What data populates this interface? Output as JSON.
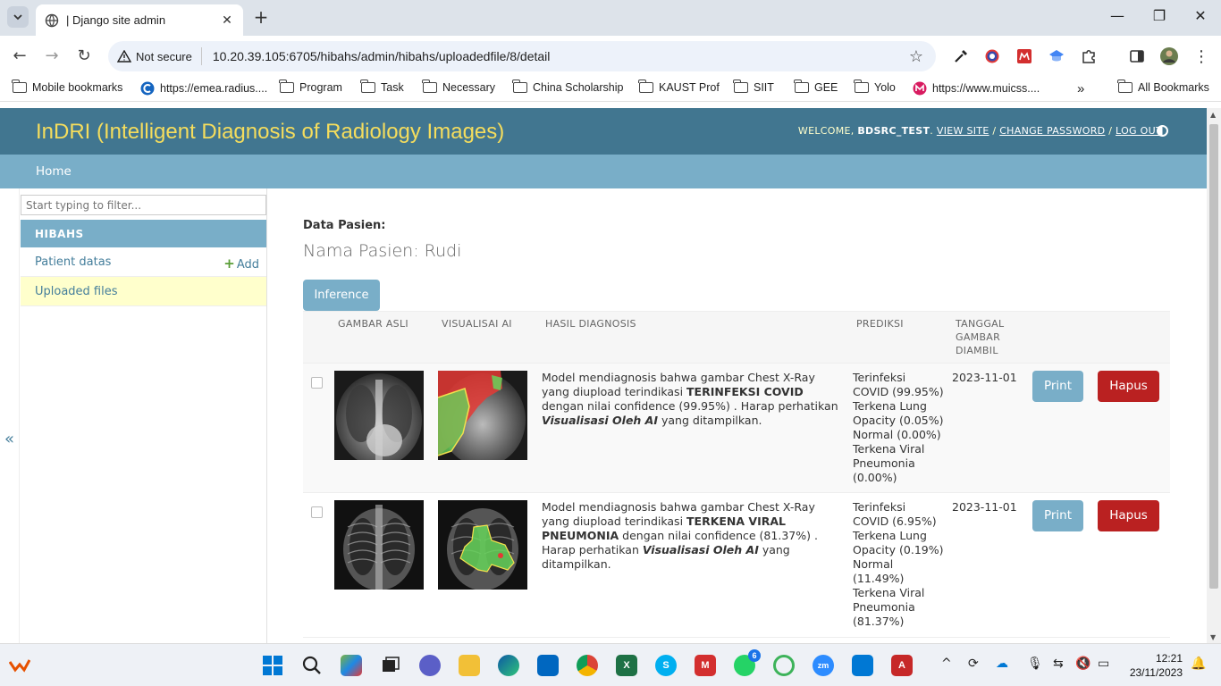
{
  "browser": {
    "tab_title": "| Django site admin",
    "security_label": "Not secure",
    "url": "10.20.39.105:6705/hibahs/admin/hibahs/uploadedfile/8/detail",
    "bookmarks": [
      {
        "label": "Mobile bookmarks",
        "icon": "folder-icon"
      },
      {
        "label": "https://emea.radius....",
        "icon": "site-icon"
      },
      {
        "label": "Program",
        "icon": "folder-icon"
      },
      {
        "label": "Task",
        "icon": "folder-icon"
      },
      {
        "label": "Necessary",
        "icon": "folder-icon"
      },
      {
        "label": "China Scholarship",
        "icon": "folder-icon"
      },
      {
        "label": "KAUST Prof",
        "icon": "folder-icon"
      },
      {
        "label": "SIIT",
        "icon": "folder-icon"
      },
      {
        "label": "GEE",
        "icon": "folder-icon"
      },
      {
        "label": "Yolo",
        "icon": "folder-icon"
      },
      {
        "label": "https://www.muicss....",
        "icon": "site-icon"
      }
    ],
    "all_bookmarks": "All Bookmarks"
  },
  "admin": {
    "brand": "InDRI (Intelligent Diagnosis of Radiology Images)",
    "welcome": "WELCOME,",
    "username": "BDSRC_TEST",
    "view_site": "VIEW SITE",
    "change_password": "CHANGE PASSWORD",
    "logout": "LOG OUT",
    "breadcrumb_home": "Home",
    "collapse_symbol": "«",
    "colors": {
      "header": "#417690",
      "breadcrumb": "#79aec8",
      "brand": "#f5dd5d",
      "danger": "#ba2121"
    }
  },
  "sidebar": {
    "filter_placeholder": "Start typing to filter...",
    "module": "HIBAHS",
    "items": [
      {
        "label": "Patient datas",
        "add_label": "Add"
      },
      {
        "label": "Uploaded files"
      }
    ]
  },
  "main": {
    "data_label": "Data Pasien:",
    "patient_name": "Nama Pasien: Rudi",
    "inference_button": "Inference",
    "columns": [
      "GAMBAR ASLI",
      "VISUALISAI AI",
      "HASIL DIAGNOSIS",
      "PREDIKSI",
      "TANGGAL GAMBAR DIAMBIL"
    ],
    "rows": [
      {
        "diag_pre": "Model mendiagnosis bahwa gambar Chest X-Ray yang diupload terindikasi ",
        "diag_result": "TERINFEKSI COVID",
        "diag_mid": " dengan nilai confidence (99.95%) . Harap perhatikan ",
        "diag_emph": "Visualisasi Oleh AI",
        "diag_post": " yang ditampilkan.",
        "predictions": [
          "Terinfeksi COVID (99.95%)",
          "Terkena Lung Opacity (0.05%)",
          "Normal (0.00%)",
          "Terkena Viral Pneumonia (0.00%)"
        ],
        "date": "2023-11-01",
        "print": "Print",
        "delete": "Hapus"
      },
      {
        "diag_pre": "Model mendiagnosis bahwa gambar Chest X-Ray yang diupload terindikasi ",
        "diag_result": "TERKENA VIRAL PNEUMONIA",
        "diag_mid": " dengan nilai confidence (81.37%) . Harap perhatikan ",
        "diag_emph": "Visualisasi Oleh AI",
        "diag_post": " yang ditampilkan.",
        "predictions": [
          "Terinfeksi COVID (6.95%)",
          "Terkena Lung Opacity (0.19%)",
          "Normal (11.49%)",
          "Terkena Viral Pneumonia (81.37%)"
        ],
        "date": "2023-11-01",
        "print": "Print",
        "delete": "Hapus"
      }
    ]
  },
  "taskbar": {
    "time": "12:21",
    "date": "23/11/2023",
    "whatsapp_badge": "6"
  }
}
